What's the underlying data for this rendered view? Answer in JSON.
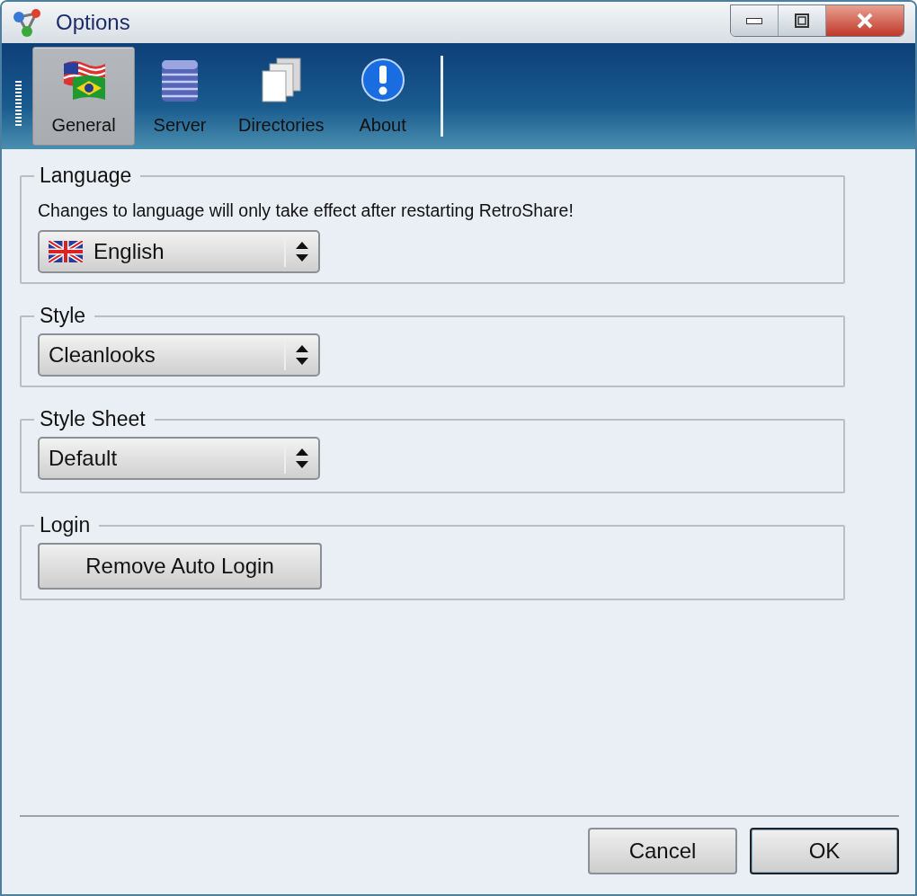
{
  "window": {
    "title": "Options"
  },
  "tabs": [
    {
      "label": "General",
      "kind": "flags",
      "selected": true
    },
    {
      "label": "Server",
      "kind": "server",
      "selected": false
    },
    {
      "label": "Directories",
      "kind": "documents",
      "selected": false
    },
    {
      "label": "About",
      "kind": "info",
      "selected": false
    }
  ],
  "groups": [
    {
      "title": "Language",
      "note": "Changes to language will only take effect after restarting RetroShare!",
      "control": {
        "kind": "flagcombo",
        "value": "English"
      }
    },
    {
      "title": "Style",
      "control": {
        "kind": "combo",
        "value": "Cleanlooks"
      }
    },
    {
      "title": "Style Sheet",
      "control": {
        "kind": "combo",
        "value": "Default"
      }
    },
    {
      "title": "Login",
      "control": {
        "kind": "button",
        "label": "Remove Auto Login"
      }
    }
  ],
  "buttons": [
    {
      "label": "Cancel",
      "default": false
    },
    {
      "label": "OK",
      "default": true
    }
  ]
}
